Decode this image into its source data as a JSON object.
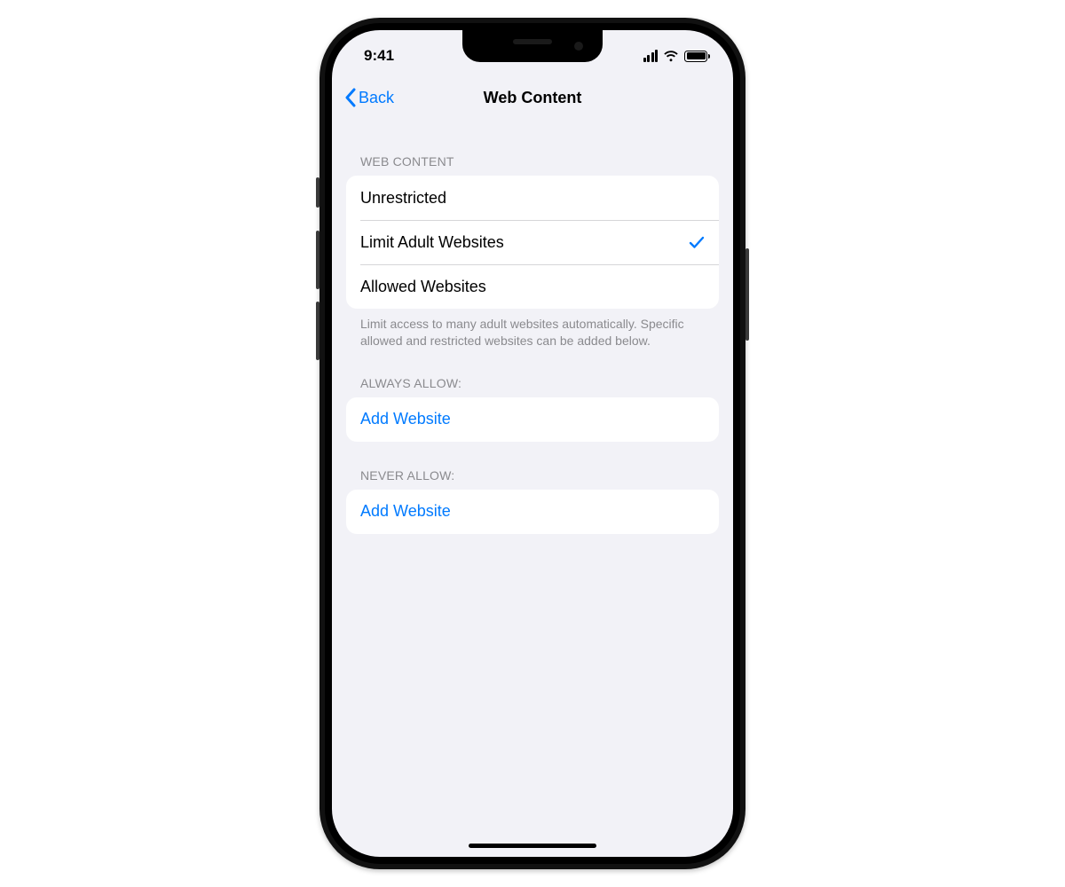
{
  "statusBar": {
    "time": "9:41"
  },
  "nav": {
    "backLabel": "Back",
    "title": "Web Content"
  },
  "sections": {
    "webContent": {
      "header": "WEB CONTENT",
      "options": [
        {
          "label": "Unrestricted",
          "selected": false
        },
        {
          "label": "Limit Adult Websites",
          "selected": true
        },
        {
          "label": "Allowed Websites",
          "selected": false
        }
      ],
      "footer": "Limit access to many adult websites automatically. Specific allowed and restricted websites can be added below."
    },
    "alwaysAllow": {
      "header": "ALWAYS ALLOW:",
      "addLabel": "Add Website"
    },
    "neverAllow": {
      "header": "NEVER ALLOW:",
      "addLabel": "Add Website"
    }
  },
  "colors": {
    "accent": "#007aff",
    "background": "#f2f2f7",
    "cell": "#ffffff",
    "secondaryText": "#8a8a8e"
  }
}
